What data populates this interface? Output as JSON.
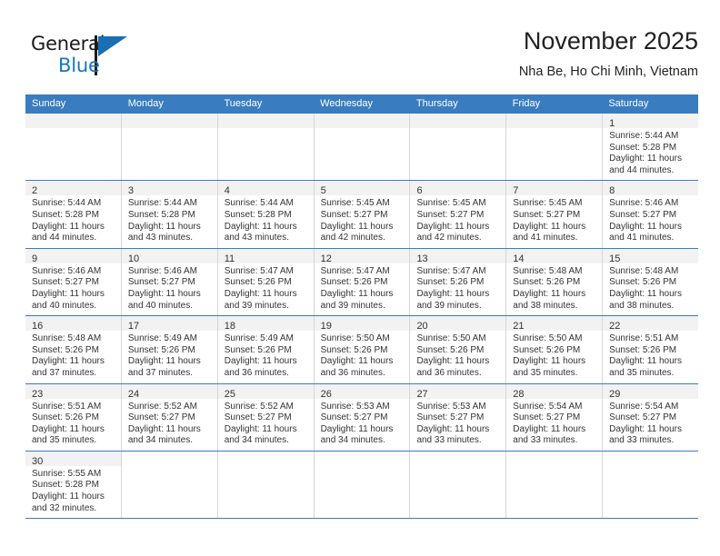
{
  "brand": {
    "name_top": "General",
    "name_bottom": "Blue",
    "triangle_color": "#1a6fb4",
    "accent_color": "#1477c0"
  },
  "header": {
    "title": "November 2025",
    "subtitle": "Nha Be, Ho Chi Minh, Vietnam"
  },
  "theme": {
    "header_bg": "#3a7cc0",
    "date_bar_bg": "#f2f2f2",
    "grid_line": "#d7d7d7",
    "row_line": "#3a7cc0"
  },
  "calendar": {
    "weekdays": [
      "Sunday",
      "Monday",
      "Tuesday",
      "Wednesday",
      "Thursday",
      "Friday",
      "Saturday"
    ],
    "weeks": [
      [
        {
          "day": "",
          "empty": true
        },
        {
          "day": "",
          "empty": true
        },
        {
          "day": "",
          "empty": true
        },
        {
          "day": "",
          "empty": true
        },
        {
          "day": "",
          "empty": true
        },
        {
          "day": "",
          "empty": true
        },
        {
          "day": "1",
          "sunrise": "Sunrise: 5:44 AM",
          "sunset": "Sunset: 5:28 PM",
          "daylight1": "Daylight: 11 hours",
          "daylight2": "and 44 minutes."
        }
      ],
      [
        {
          "day": "2",
          "sunrise": "Sunrise: 5:44 AM",
          "sunset": "Sunset: 5:28 PM",
          "daylight1": "Daylight: 11 hours",
          "daylight2": "and 44 minutes."
        },
        {
          "day": "3",
          "sunrise": "Sunrise: 5:44 AM",
          "sunset": "Sunset: 5:28 PM",
          "daylight1": "Daylight: 11 hours",
          "daylight2": "and 43 minutes."
        },
        {
          "day": "4",
          "sunrise": "Sunrise: 5:44 AM",
          "sunset": "Sunset: 5:28 PM",
          "daylight1": "Daylight: 11 hours",
          "daylight2": "and 43 minutes."
        },
        {
          "day": "5",
          "sunrise": "Sunrise: 5:45 AM",
          "sunset": "Sunset: 5:27 PM",
          "daylight1": "Daylight: 11 hours",
          "daylight2": "and 42 minutes."
        },
        {
          "day": "6",
          "sunrise": "Sunrise: 5:45 AM",
          "sunset": "Sunset: 5:27 PM",
          "daylight1": "Daylight: 11 hours",
          "daylight2": "and 42 minutes."
        },
        {
          "day": "7",
          "sunrise": "Sunrise: 5:45 AM",
          "sunset": "Sunset: 5:27 PM",
          "daylight1": "Daylight: 11 hours",
          "daylight2": "and 41 minutes."
        },
        {
          "day": "8",
          "sunrise": "Sunrise: 5:46 AM",
          "sunset": "Sunset: 5:27 PM",
          "daylight1": "Daylight: 11 hours",
          "daylight2": "and 41 minutes."
        }
      ],
      [
        {
          "day": "9",
          "sunrise": "Sunrise: 5:46 AM",
          "sunset": "Sunset: 5:27 PM",
          "daylight1": "Daylight: 11 hours",
          "daylight2": "and 40 minutes."
        },
        {
          "day": "10",
          "sunrise": "Sunrise: 5:46 AM",
          "sunset": "Sunset: 5:27 PM",
          "daylight1": "Daylight: 11 hours",
          "daylight2": "and 40 minutes."
        },
        {
          "day": "11",
          "sunrise": "Sunrise: 5:47 AM",
          "sunset": "Sunset: 5:26 PM",
          "daylight1": "Daylight: 11 hours",
          "daylight2": "and 39 minutes."
        },
        {
          "day": "12",
          "sunrise": "Sunrise: 5:47 AM",
          "sunset": "Sunset: 5:26 PM",
          "daylight1": "Daylight: 11 hours",
          "daylight2": "and 39 minutes."
        },
        {
          "day": "13",
          "sunrise": "Sunrise: 5:47 AM",
          "sunset": "Sunset: 5:26 PM",
          "daylight1": "Daylight: 11 hours",
          "daylight2": "and 39 minutes."
        },
        {
          "day": "14",
          "sunrise": "Sunrise: 5:48 AM",
          "sunset": "Sunset: 5:26 PM",
          "daylight1": "Daylight: 11 hours",
          "daylight2": "and 38 minutes."
        },
        {
          "day": "15",
          "sunrise": "Sunrise: 5:48 AM",
          "sunset": "Sunset: 5:26 PM",
          "daylight1": "Daylight: 11 hours",
          "daylight2": "and 38 minutes."
        }
      ],
      [
        {
          "day": "16",
          "sunrise": "Sunrise: 5:48 AM",
          "sunset": "Sunset: 5:26 PM",
          "daylight1": "Daylight: 11 hours",
          "daylight2": "and 37 minutes."
        },
        {
          "day": "17",
          "sunrise": "Sunrise: 5:49 AM",
          "sunset": "Sunset: 5:26 PM",
          "daylight1": "Daylight: 11 hours",
          "daylight2": "and 37 minutes."
        },
        {
          "day": "18",
          "sunrise": "Sunrise: 5:49 AM",
          "sunset": "Sunset: 5:26 PM",
          "daylight1": "Daylight: 11 hours",
          "daylight2": "and 36 minutes."
        },
        {
          "day": "19",
          "sunrise": "Sunrise: 5:50 AM",
          "sunset": "Sunset: 5:26 PM",
          "daylight1": "Daylight: 11 hours",
          "daylight2": "and 36 minutes."
        },
        {
          "day": "20",
          "sunrise": "Sunrise: 5:50 AM",
          "sunset": "Sunset: 5:26 PM",
          "daylight1": "Daylight: 11 hours",
          "daylight2": "and 36 minutes."
        },
        {
          "day": "21",
          "sunrise": "Sunrise: 5:50 AM",
          "sunset": "Sunset: 5:26 PM",
          "daylight1": "Daylight: 11 hours",
          "daylight2": "and 35 minutes."
        },
        {
          "day": "22",
          "sunrise": "Sunrise: 5:51 AM",
          "sunset": "Sunset: 5:26 PM",
          "daylight1": "Daylight: 11 hours",
          "daylight2": "and 35 minutes."
        }
      ],
      [
        {
          "day": "23",
          "sunrise": "Sunrise: 5:51 AM",
          "sunset": "Sunset: 5:26 PM",
          "daylight1": "Daylight: 11 hours",
          "daylight2": "and 35 minutes."
        },
        {
          "day": "24",
          "sunrise": "Sunrise: 5:52 AM",
          "sunset": "Sunset: 5:27 PM",
          "daylight1": "Daylight: 11 hours",
          "daylight2": "and 34 minutes."
        },
        {
          "day": "25",
          "sunrise": "Sunrise: 5:52 AM",
          "sunset": "Sunset: 5:27 PM",
          "daylight1": "Daylight: 11 hours",
          "daylight2": "and 34 minutes."
        },
        {
          "day": "26",
          "sunrise": "Sunrise: 5:53 AM",
          "sunset": "Sunset: 5:27 PM",
          "daylight1": "Daylight: 11 hours",
          "daylight2": "and 34 minutes."
        },
        {
          "day": "27",
          "sunrise": "Sunrise: 5:53 AM",
          "sunset": "Sunset: 5:27 PM",
          "daylight1": "Daylight: 11 hours",
          "daylight2": "and 33 minutes."
        },
        {
          "day": "28",
          "sunrise": "Sunrise: 5:54 AM",
          "sunset": "Sunset: 5:27 PM",
          "daylight1": "Daylight: 11 hours",
          "daylight2": "and 33 minutes."
        },
        {
          "day": "29",
          "sunrise": "Sunrise: 5:54 AM",
          "sunset": "Sunset: 5:27 PM",
          "daylight1": "Daylight: 11 hours",
          "daylight2": "and 33 minutes."
        }
      ],
      [
        {
          "day": "30",
          "sunrise": "Sunrise: 5:55 AM",
          "sunset": "Sunset: 5:28 PM",
          "daylight1": "Daylight: 11 hours",
          "daylight2": "and 32 minutes."
        },
        {
          "day": "",
          "empty": true,
          "blank": true
        },
        {
          "day": "",
          "empty": true,
          "blank": true
        },
        {
          "day": "",
          "empty": true,
          "blank": true
        },
        {
          "day": "",
          "empty": true,
          "blank": true
        },
        {
          "day": "",
          "empty": true,
          "blank": true
        },
        {
          "day": "",
          "empty": true,
          "blank": true
        }
      ]
    ]
  }
}
